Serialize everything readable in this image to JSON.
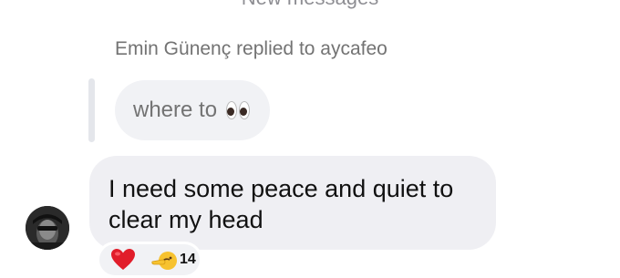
{
  "thread": {
    "divider_label": "New messages",
    "reply_header": "Emin Günenç replied to aycafeo",
    "quoted_message": {
      "text": "where to",
      "emoji_icon": "eyes-emoji-icon"
    },
    "message": {
      "text": "I need some peace and quiet to clear my head",
      "avatar_icon": "avatar"
    },
    "reactions": {
      "items": [
        "heart-emoji-icon",
        "shushing-face-emoji-icon"
      ],
      "count": "14"
    }
  },
  "colors": {
    "bubble_bg": "#efeff3",
    "secondary_text": "#737373",
    "heart": "#e11d2a"
  }
}
